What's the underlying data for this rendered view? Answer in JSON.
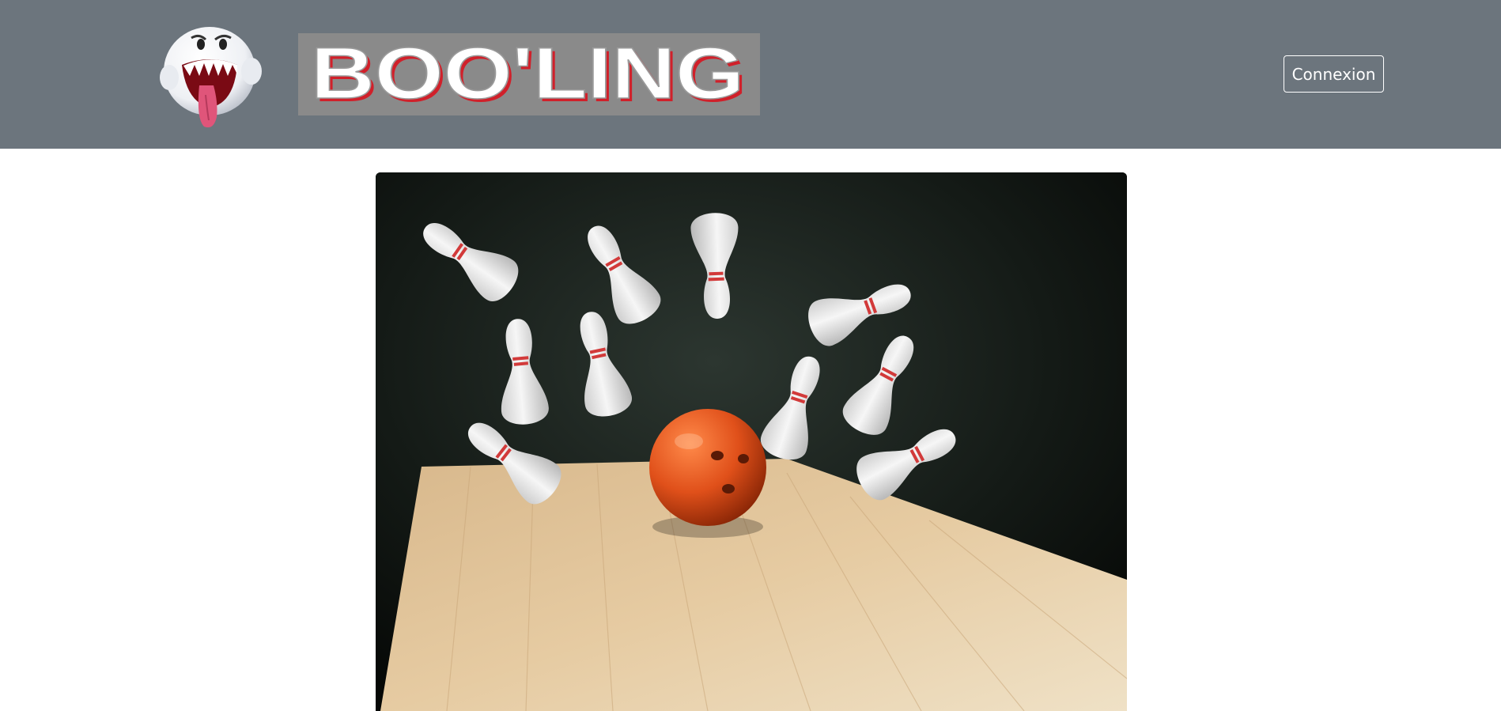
{
  "header": {
    "brand_wordmark": "BOO'LING",
    "logo_icon": "ghost-icon",
    "login_label": "Connexion"
  },
  "hero": {
    "image_subject": "bowling-strike-image"
  },
  "colors": {
    "navbar": "#6c757d",
    "wordmark_bg": "#8a8a8a",
    "wordmark_text": "#ffffff",
    "wordmark_shadow": "#d0202a",
    "ball": "#e0501a"
  }
}
